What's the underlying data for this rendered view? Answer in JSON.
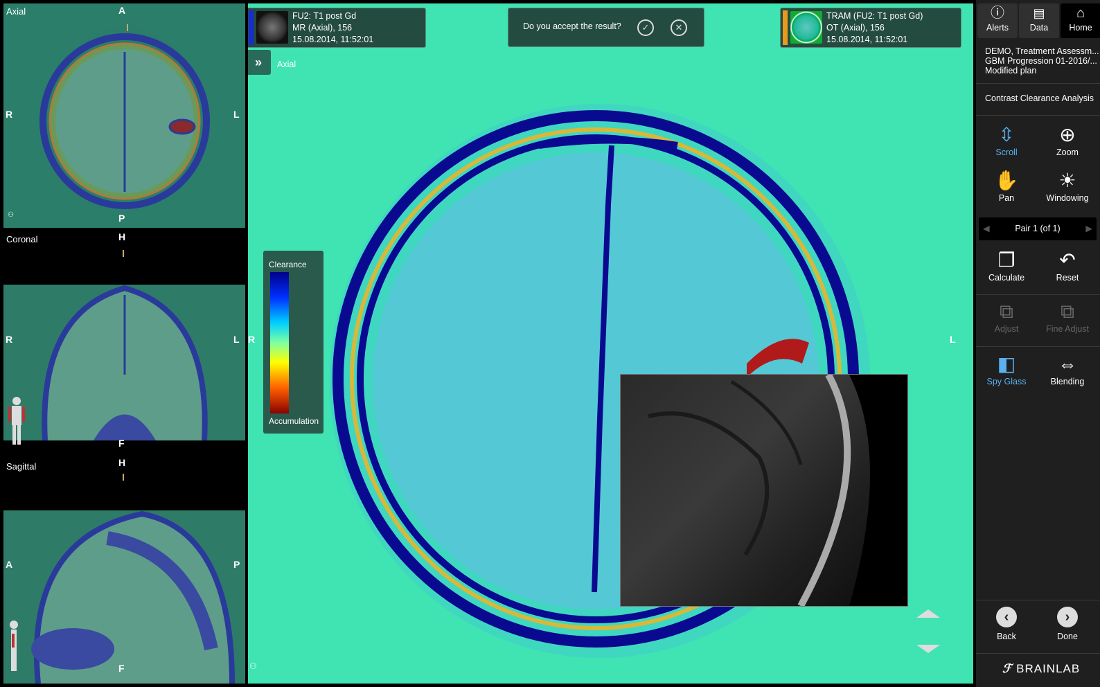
{
  "left_views": {
    "axial": {
      "title": "Axial",
      "top": "A",
      "bottom": "P",
      "left": "R",
      "right": "L"
    },
    "coronal": {
      "title": "Coronal",
      "top": "H",
      "bottom": "F",
      "left": "R",
      "right": "L"
    },
    "sagittal": {
      "title": "Sagittal",
      "top": "H",
      "bottom": "F",
      "left": "A",
      "right": "P"
    }
  },
  "main": {
    "view_label": "Axial",
    "left_orient": "R",
    "right_orient": "L",
    "series_left": {
      "line1": "FU2: T1 post Gd",
      "line2": "MR (Axial), 156",
      "line3": "15.08.2014, 11:52:01",
      "color": "#1a2bd6"
    },
    "series_right": {
      "line1": "TRAM (FU2: T1 post Gd)",
      "line2": "OT (Axial), 156",
      "line3": "15.08.2014, 11:52:01",
      "color": "#e99a1a"
    },
    "accept_prompt": "Do you accept the result?",
    "legend": {
      "top_label": "Clearance",
      "bottom_label": "Accumulation"
    }
  },
  "right_panel": {
    "top_buttons": [
      {
        "label": "Alerts",
        "icon": "info-icon"
      },
      {
        "label": "Data",
        "icon": "data-icon"
      },
      {
        "label": "Home",
        "icon": "home-icon"
      }
    ],
    "plan_info": {
      "line1": "DEMO, Treatment Assessm...",
      "line2": "GBM Progression 01-2016/...",
      "line3": "Modified plan"
    },
    "analysis_title": "Contrast Clearance Analysis",
    "tools": {
      "scroll": "Scroll",
      "zoom": "Zoom",
      "pan": "Pan",
      "windowing": "Windowing",
      "pair": "Pair 1 (of 1)",
      "calculate": "Calculate",
      "reset": "Reset",
      "adjust": "Adjust",
      "fine_adjust": "Fine Adjust",
      "spy_glass": "Spy Glass",
      "blending": "Blending"
    },
    "nav": {
      "back": "Back",
      "done": "Done"
    },
    "brand": "BRAINLAB"
  },
  "colors": {
    "accent": "#5ab0f0",
    "viewport_bg": "#40e3b2",
    "panel_bg": "#1f1f1f"
  }
}
